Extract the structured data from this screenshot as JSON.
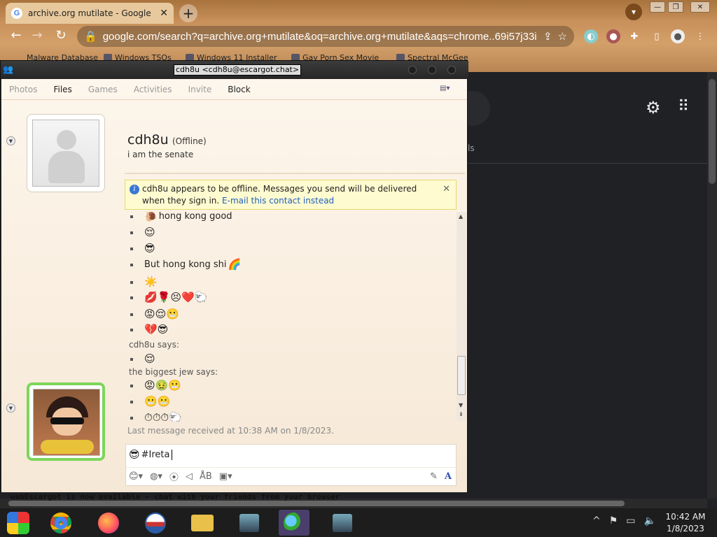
{
  "browser": {
    "tab_title": "archive.org mutilate - Google Sea",
    "tab_close": "✕",
    "new_tab": "+",
    "url": "google.com/search?q=archive.org+mutilate&oq=archive.org+mutilate&aqs=chrome..69i57j33i...",
    "bookmarks": [
      "Malware Database",
      "Windows TSOs",
      "Windows 11 Installer",
      "Gay Porn Sex Movie",
      "Spectral McGee"
    ],
    "window_controls": {
      "minimize": "—",
      "restore": "❐",
      "close": "✕"
    }
  },
  "google": {
    "partial_label": "ls"
  },
  "messenger": {
    "window_title": "cdh8u <cdh8u@escargot.chat>",
    "menu": [
      "Photos",
      "Files",
      "Games",
      "Activities",
      "Invite",
      "Block"
    ],
    "contact_name": "cdh8u",
    "contact_status": "(Offline)",
    "contact_message": "i am the senate",
    "offline_notice": "cdh8u appears to be offline. Messages you send will be delivered when they sign in.",
    "offline_link": "E-mail this contact instead",
    "conversation": [
      {
        "type": "msg",
        "text": "hong kong good",
        "emoji": "🐌"
      },
      {
        "type": "msg",
        "text": "",
        "emoji": "😌"
      },
      {
        "type": "msg",
        "text": "",
        "emoji": "😎"
      },
      {
        "type": "msg",
        "text": "But hong kong shi",
        "emoji": "🌈"
      },
      {
        "type": "msg",
        "text": "",
        "emoji": "☀️"
      },
      {
        "type": "msg",
        "text": "",
        "emoji": "💋🌹😣❤️🐑"
      },
      {
        "type": "msg",
        "text": "",
        "emoji": "😡😌😬"
      },
      {
        "type": "msg",
        "text": "",
        "emoji": "💔😎"
      },
      {
        "type": "says",
        "text": "cdh8u says:"
      },
      {
        "type": "msg",
        "text": "",
        "emoji": "😌"
      },
      {
        "type": "says",
        "text": "the biggest jew says:"
      },
      {
        "type": "msg",
        "text": "",
        "emoji": "😡🤢😬"
      },
      {
        "type": "msg",
        "text": "",
        "emoji": "😬😬"
      },
      {
        "type": "msg",
        "text": "",
        "emoji": "⏱⏱⏱🐑"
      }
    ],
    "last_message": "Last message received at 10:38 AM on 1/8/2023.",
    "input_text": "#Ireta",
    "input_emoji": "😎",
    "web_notice": "webEscargot is now available - chat with your friends from your browser"
  },
  "taskbar": {
    "time": "10:42 AM",
    "date": "1/8/2023"
  }
}
